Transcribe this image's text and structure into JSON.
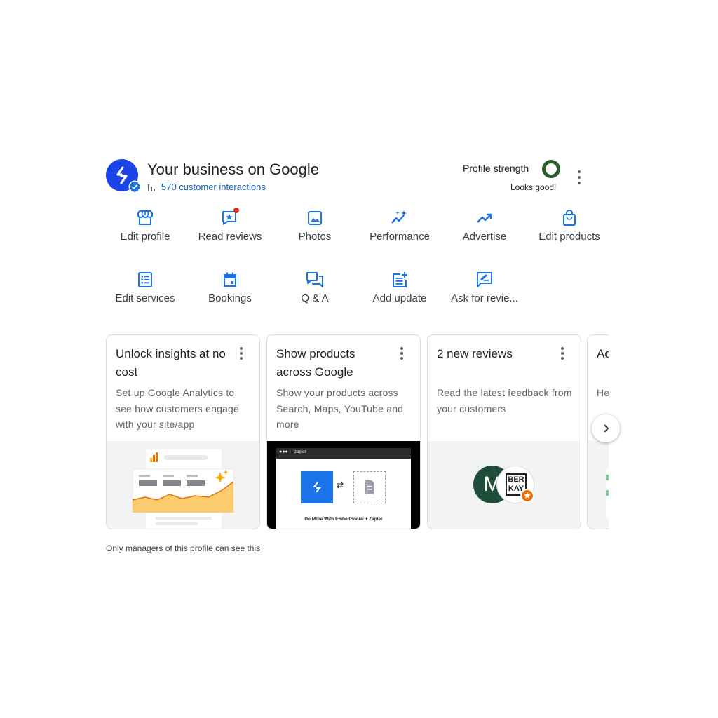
{
  "header": {
    "title": "Your business on Google",
    "interactions": "570 customer interactions",
    "interactions_icon": "bar-chart-icon",
    "profile_strength_label": "Profile strength",
    "profile_strength_status": "Looks good!",
    "profile_strength_color": "#2e5d2e",
    "brand_color": "#1a44e8"
  },
  "actions": [
    {
      "label": "Edit profile",
      "icon": "storefront-icon"
    },
    {
      "label": "Read reviews",
      "icon": "review-star-icon",
      "badge": true
    },
    {
      "label": "Photos",
      "icon": "image-icon"
    },
    {
      "label": "Performance",
      "icon": "sparkle-trend-icon"
    },
    {
      "label": "Advertise",
      "icon": "trending-up-icon"
    },
    {
      "label": "Edit products",
      "icon": "shopping-bag-icon"
    },
    {
      "label": "Edit services",
      "icon": "list-icon"
    },
    {
      "label": "Bookings",
      "icon": "calendar-icon"
    },
    {
      "label": "Q & A",
      "icon": "forum-icon"
    },
    {
      "label": "Add update",
      "icon": "post-add-icon"
    },
    {
      "label": "Ask for revie...",
      "icon": "rate-review-icon"
    }
  ],
  "cards": [
    {
      "title": "Unlock insights at no cost",
      "description": "Set up Google Analytics to see how customers engage with your site/app"
    },
    {
      "title": "Show products across Google",
      "description": "Show your products across Search, Maps, YouTube and more",
      "media_top_label": "zapier",
      "media_caption": "Do More With EmbedSocial + Zapier"
    },
    {
      "title": "2 new reviews",
      "description": "Read the latest feedback from your customers",
      "avatar_letter": "M",
      "avatar_logo_line1": "BER",
      "avatar_logo_line2": "KAY"
    },
    {
      "title": "Ad yo",
      "description": "He vis"
    }
  ],
  "footnote": "Only managers of this profile can see this",
  "accent_color": "#1a73e8"
}
